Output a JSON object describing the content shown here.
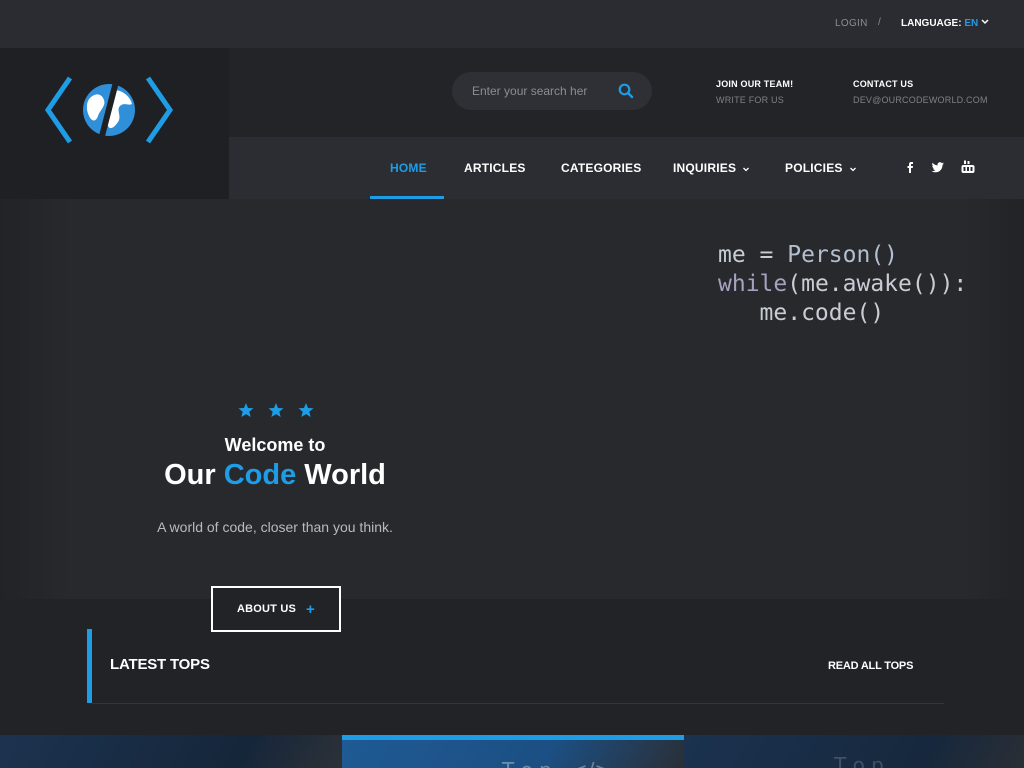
{
  "colors": {
    "accent": "#1e9de6",
    "background": "#222327",
    "nav_bg": "#2b2d33"
  },
  "topbar": {
    "login": "LOGIN",
    "separator": "/",
    "language_label": "LANGUAGE:",
    "language_code": "EN",
    "language_icon": "chevron-down-icon"
  },
  "search": {
    "placeholder": "Enter your search her",
    "icon": "search-icon"
  },
  "header": {
    "join_title": "JOIN OUR TEAM!",
    "join_sub": "WRITE FOR US",
    "contact_title": "CONTACT US",
    "contact_sub": "DEV@OURCODEWORLD.COM"
  },
  "nav": {
    "items": [
      {
        "label": "HOME",
        "active": true
      },
      {
        "label": "ARTICLES"
      },
      {
        "label": "CATEGORIES"
      },
      {
        "label": "INQUIRIES",
        "dropdown": true
      },
      {
        "label": "POLICIES",
        "dropdown": true
      }
    ],
    "social": [
      "facebook-icon",
      "twitter-icon",
      "youtube-icon"
    ]
  },
  "hero": {
    "code_line1_var": "me",
    "code_line1_eq": " = ",
    "code_line1_call": "Person()",
    "code_line2_kw": "while",
    "code_line2_rest": "(me.awake()):",
    "code_line3": "me.code()",
    "welcome": "Welcome to",
    "headline_pre": "Our ",
    "headline_highlight": "Code",
    "headline_post": " World",
    "tagline": "A world of code, closer than you think.",
    "about_button": "ABOUT US",
    "about_plus": "+"
  },
  "latest": {
    "title": "LATEST TOPS",
    "link": "READ ALL TOPS"
  }
}
